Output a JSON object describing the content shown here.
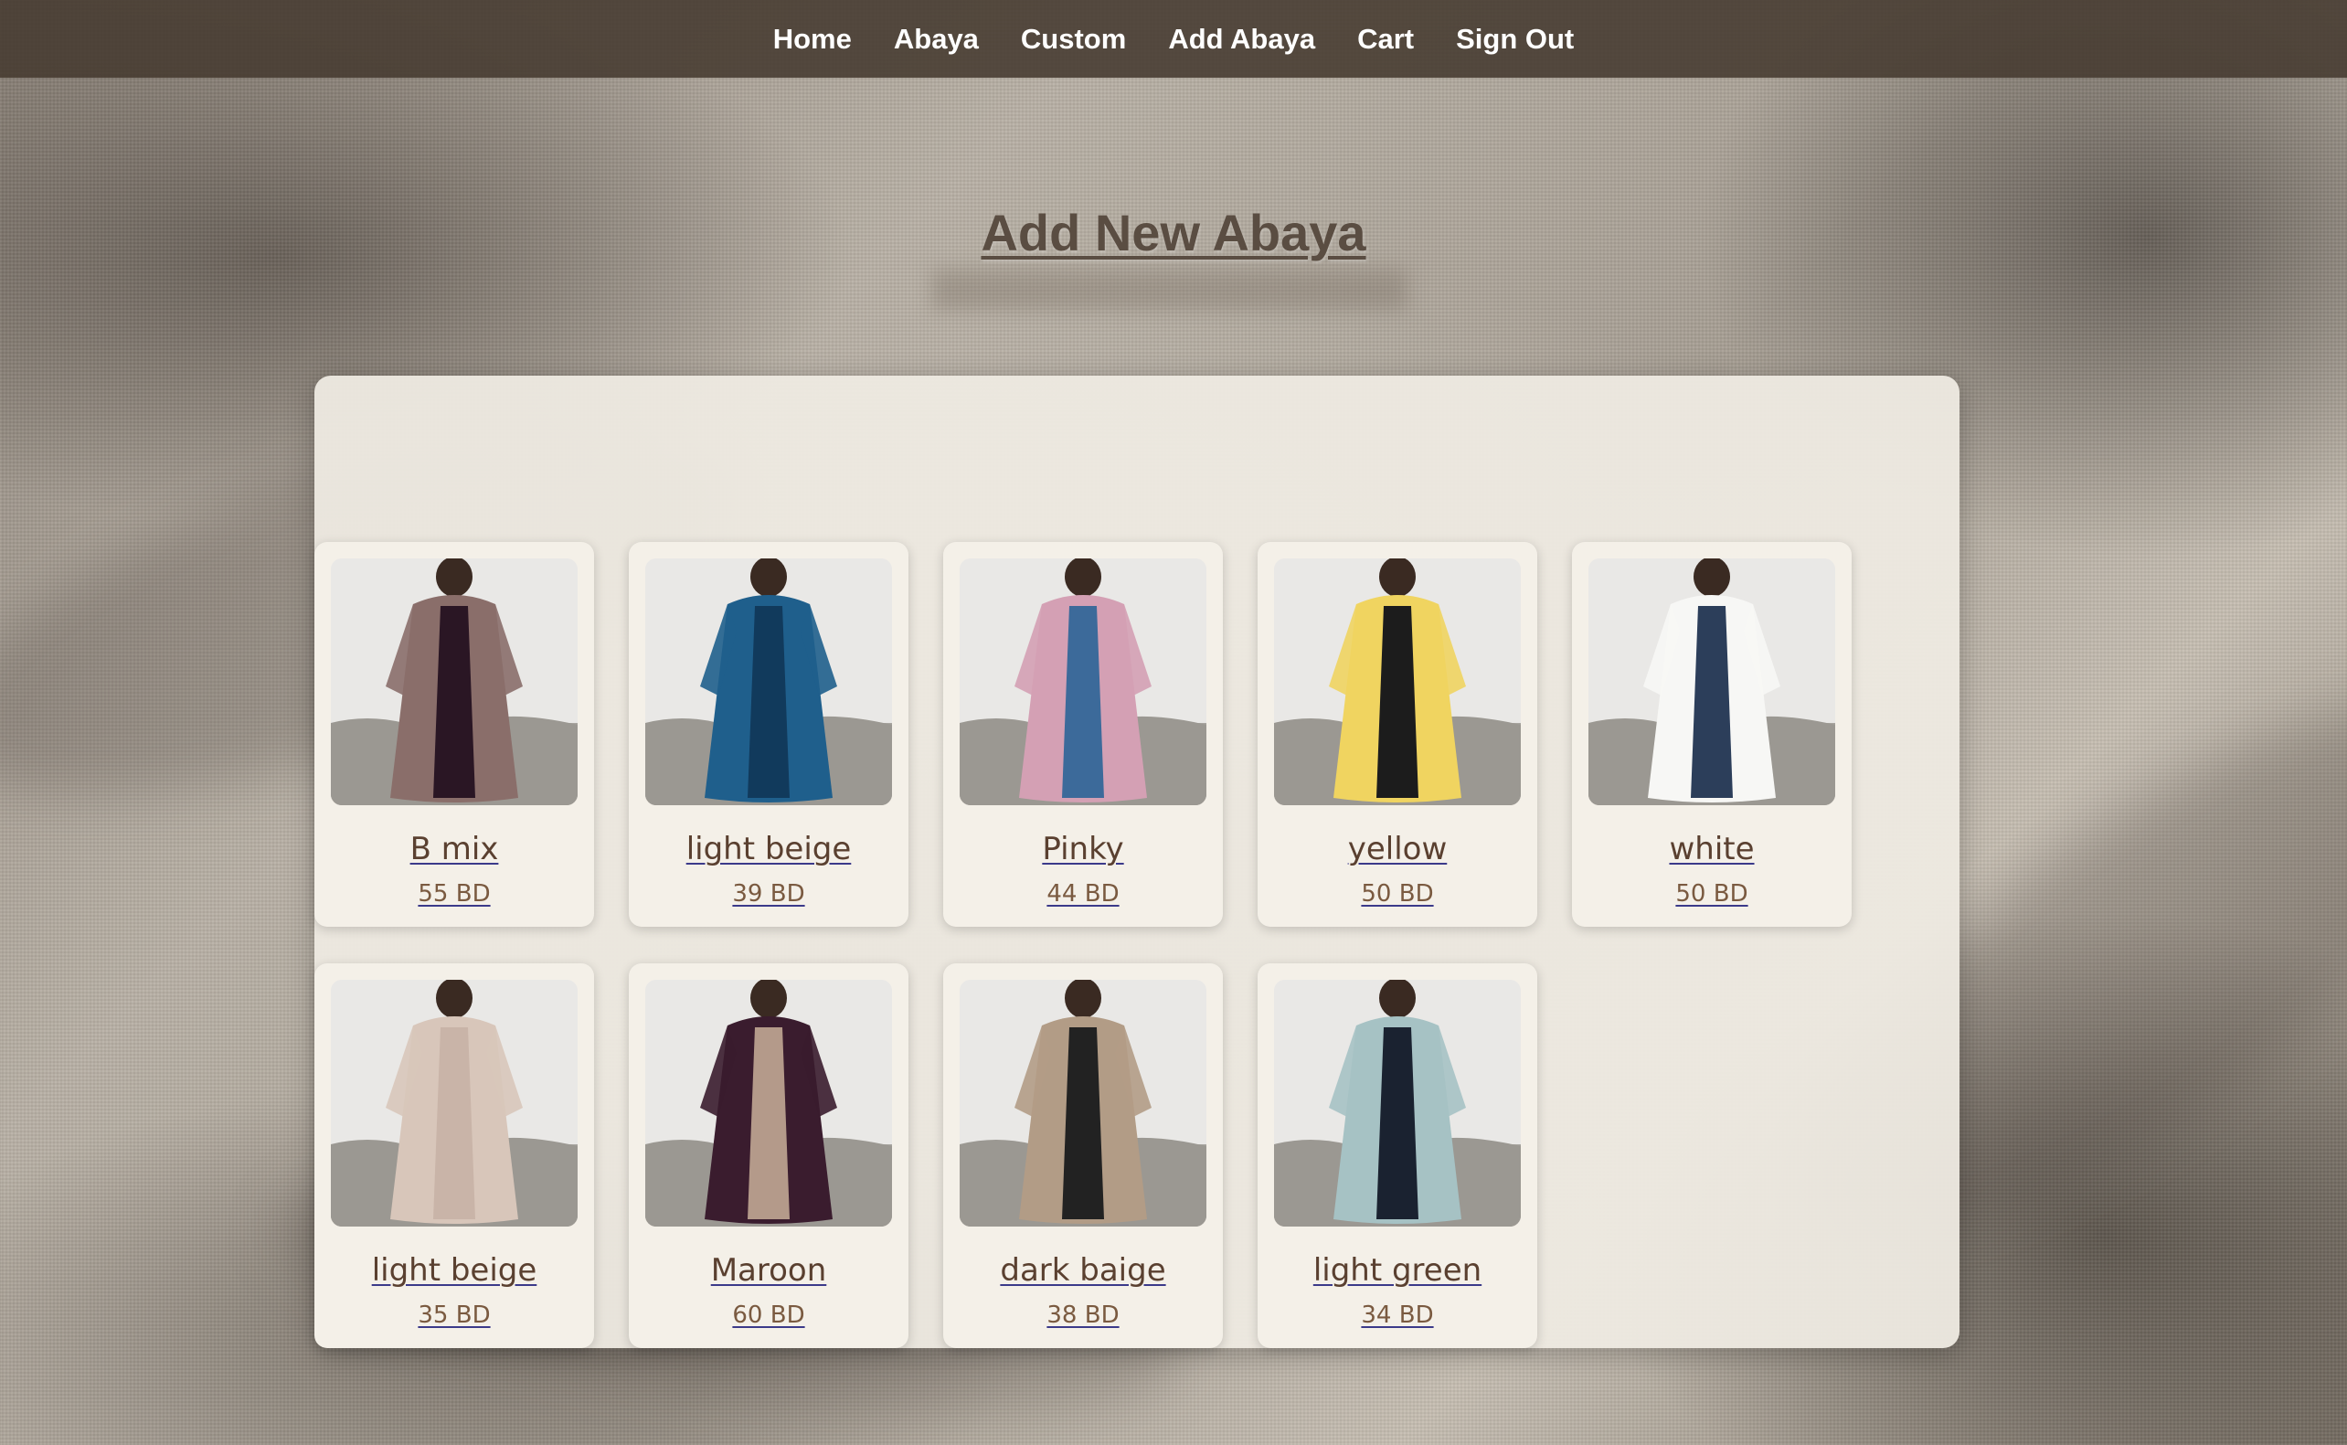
{
  "nav": {
    "items": [
      {
        "label": "Home"
      },
      {
        "label": "Abaya"
      },
      {
        "label": "Custom"
      },
      {
        "label": "Add Abaya"
      },
      {
        "label": "Cart"
      },
      {
        "label": "Sign Out"
      }
    ]
  },
  "page": {
    "title": "Add New Abaya"
  },
  "products": [
    {
      "name": "B mix",
      "price": "55 BD",
      "outer_color": "#8a6e6a",
      "inner_color": "#2a1624"
    },
    {
      "name": "light beige",
      "price": "39 BD",
      "outer_color": "#1f5f8c",
      "inner_color": "#113a5c"
    },
    {
      "name": "Pinky",
      "price": "44 BD",
      "outer_color": "#d4a0b4",
      "inner_color": "#3c6a9a"
    },
    {
      "name": "yellow",
      "price": "50 BD",
      "outer_color": "#f0d460",
      "inner_color": "#1c1c1c"
    },
    {
      "name": "white",
      "price": "50 BD",
      "outer_color": "#f7f7f5",
      "inner_color": "#2c3e5a"
    },
    {
      "name": "light beige",
      "price": "35 BD",
      "outer_color": "#d8c6ba",
      "inner_color": "#c9b4a8"
    },
    {
      "name": "Maroon",
      "price": "60 BD",
      "outer_color": "#3a1c2e",
      "inner_color": "#b49a8a"
    },
    {
      "name": "dark baige",
      "price": "38 BD",
      "outer_color": "#b29c86",
      "inner_color": "#222222"
    },
    {
      "name": "light green",
      "price": "34 BD",
      "outer_color": "#a6c2c4",
      "inner_color": "#1a2230"
    }
  ]
}
